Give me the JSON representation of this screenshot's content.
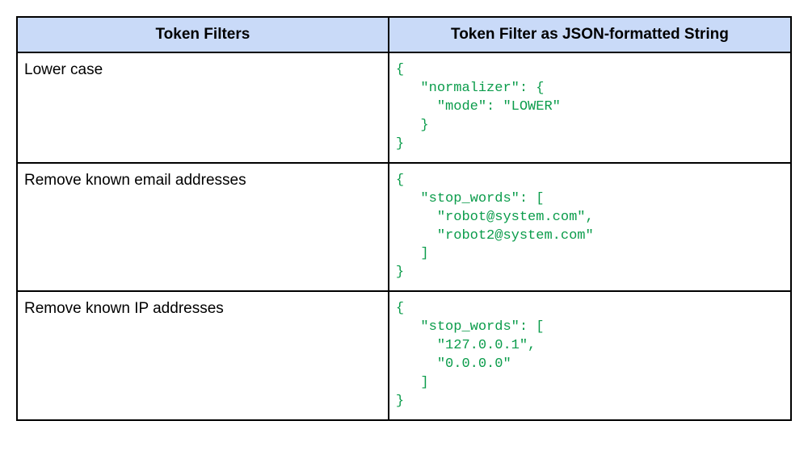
{
  "headers": {
    "col1": "Token Filters",
    "col2": "Token Filter as JSON-formatted String"
  },
  "rows": [
    {
      "name": "Lower case",
      "json": "{\n   \"normalizer\": {\n     \"mode\": \"LOWER\"\n   }\n}"
    },
    {
      "name": "Remove known email addresses",
      "json": "{\n   \"stop_words\": [\n     \"robot@system.com\",\n     \"robot2@system.com\"\n   ]\n}"
    },
    {
      "name": "Remove known IP addresses",
      "json": "{\n   \"stop_words\": [\n     \"127.0.0.1\",\n     \"0.0.0.0\"\n   ]\n}"
    }
  ],
  "chart_data": {
    "type": "table",
    "columns": [
      "Token Filters",
      "Token Filter as JSON-formatted String"
    ],
    "rows": [
      [
        "Lower case",
        "{ \"normalizer\": { \"mode\": \"LOWER\" } }"
      ],
      [
        "Remove known email addresses",
        "{ \"stop_words\": [ \"robot@system.com\", \"robot2@system.com\" ] }"
      ],
      [
        "Remove known IP addresses",
        "{ \"stop_words\": [ \"127.0.0.1\", \"0.0.0.0\" ] }"
      ]
    ]
  }
}
